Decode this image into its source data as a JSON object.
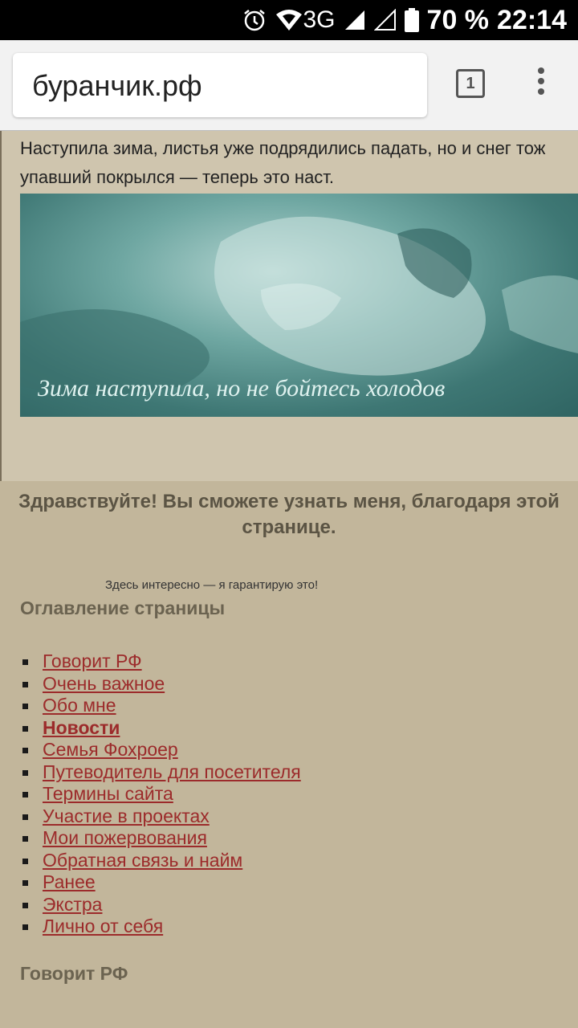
{
  "status_bar": {
    "network": "3G",
    "battery": "70 %",
    "time": "22:14",
    "icons": [
      "alarm-icon",
      "wifi-icon",
      "signal-icon",
      "signal-empty-icon",
      "battery-icon"
    ]
  },
  "browser": {
    "url": "буранчик.рф",
    "tab_count": "1",
    "menu_icon": "more-vert-icon"
  },
  "page": {
    "intro_line1": "Наступила зима, листья уже подрядились падать, но и снег тож",
    "intro_line2": "упавший покрылся — теперь это наст.",
    "banner_caption": "Зима наступила, но не бойтесь холодов",
    "greeting": "Здравствуйте! Вы сможете узнать меня, благодаря этой странице.",
    "tagline": "Здесь интересно — я гарантирую это!",
    "toc_title": "Оглавление страницы",
    "toc": [
      {
        "label": "Говорит РФ",
        "bold": false
      },
      {
        "label": "Очень важное",
        "bold": false
      },
      {
        "label": "Обо мне",
        "bold": false
      },
      {
        "label": "Новости",
        "bold": true
      },
      {
        "label": "Семья Фохроер",
        "bold": false
      },
      {
        "label": "Путеводитель для посетителя",
        "bold": false
      },
      {
        "label": "Термины сайта",
        "bold": false
      },
      {
        "label": "Участие в проектах",
        "bold": false
      },
      {
        "label": "Мои пожервования",
        "bold": false
      },
      {
        "label": "Обратная связь и найм",
        "bold": false
      },
      {
        "label": "Ранее",
        "bold": false
      },
      {
        "label": "Экстра",
        "bold": false
      },
      {
        "label": "Лично от себя",
        "bold": false
      }
    ],
    "section_title": "Говорит РФ"
  },
  "colors": {
    "page_bg": "#c2b69b",
    "link": "#9c2b2b",
    "heading": "#6b6350",
    "banner": "#5e9894"
  }
}
